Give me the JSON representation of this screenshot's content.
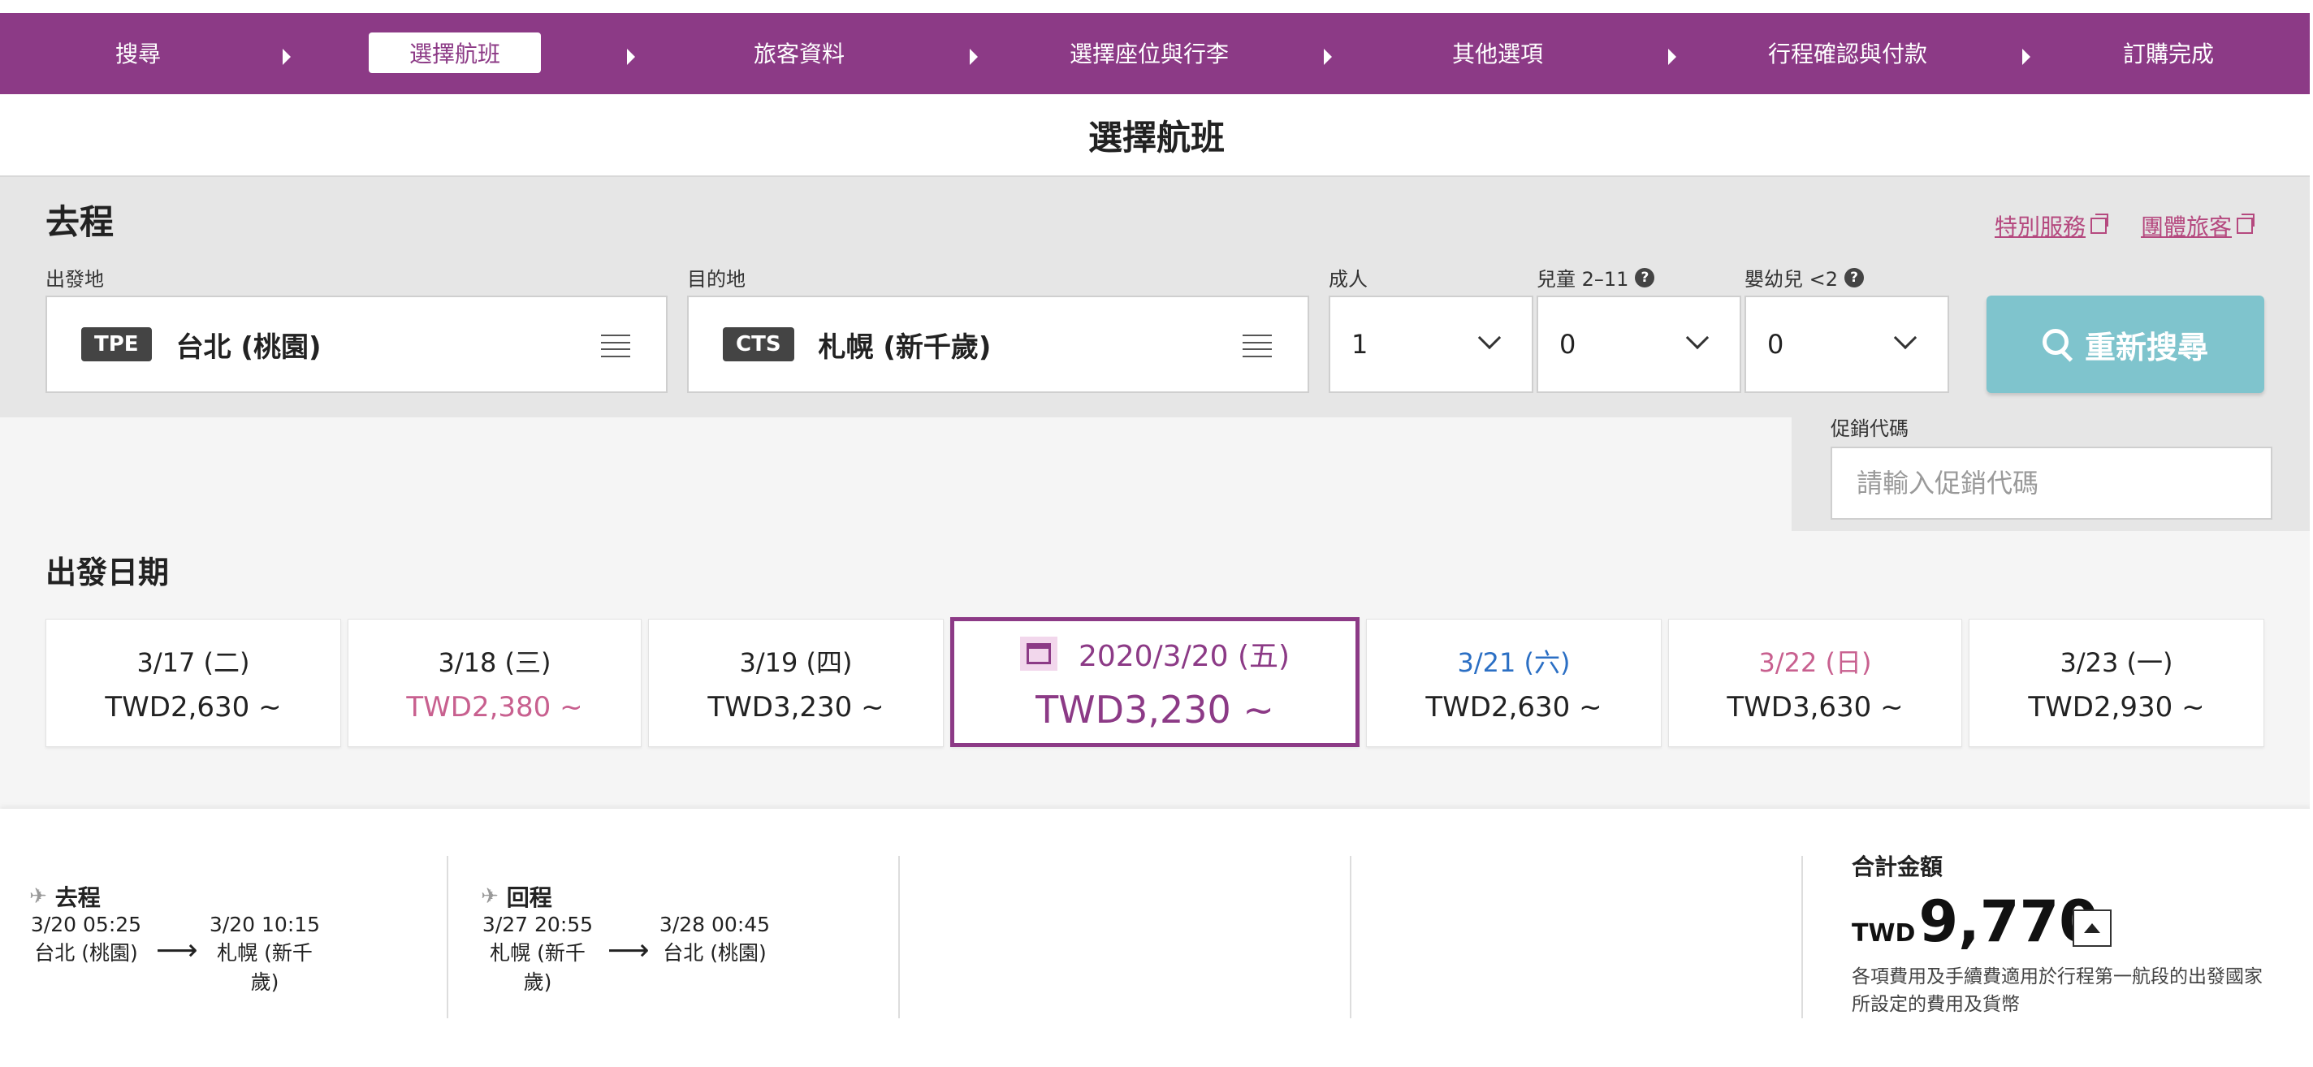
{
  "steps": [
    {
      "label": "搜尋"
    },
    {
      "label": "選擇航班",
      "active": true
    },
    {
      "label": "旅客資料"
    },
    {
      "label": "選擇座位與行李"
    },
    {
      "label": "其他選項"
    },
    {
      "label": "行程確認與付款"
    },
    {
      "label": "訂購完成"
    }
  ],
  "page_title": "選擇航班",
  "search": {
    "section_title": "去程",
    "special_service": "特別服務",
    "group_travel": "團體旅客",
    "origin": {
      "label": "出發地",
      "code": "TPE",
      "name": "台北 (桃園)"
    },
    "destination": {
      "label": "目的地",
      "code": "CTS",
      "name": "札幌 (新千歲)"
    },
    "adults": {
      "label": "成人",
      "value": "1"
    },
    "children": {
      "label": "兒童 2–11",
      "value": "0"
    },
    "infants": {
      "label": "嬰幼兒 <2",
      "value": "0"
    },
    "search_button": "重新搜尋",
    "promo": {
      "label": "促銷代碼",
      "placeholder": "請輸入促銷代碼"
    }
  },
  "dates": {
    "title": "出發日期",
    "cards": [
      {
        "date": "3/17 (二)",
        "price": "TWD2,630 ~"
      },
      {
        "date": "3/18 (三)",
        "price": "TWD2,380 ~",
        "lowest": true
      },
      {
        "date": "3/19 (四)",
        "price": "TWD3,230 ~"
      },
      {
        "date": "2020/3/20 (五)",
        "price": "TWD3,230 ~",
        "selected": true
      },
      {
        "date": "3/21 (六)",
        "price": "TWD2,630 ~",
        "day_type": "saturday"
      },
      {
        "date": "3/22 (日)",
        "price": "TWD3,630 ~",
        "day_type": "sunday"
      },
      {
        "date": "3/23 (一)",
        "price": "TWD2,930 ~"
      }
    ]
  },
  "summary": {
    "outbound": {
      "title": "去程",
      "dep_time": "3/20 05:25",
      "dep_city": "台北 (桃園)",
      "arr_time": "3/20 10:15",
      "arr_city_1": "札幌 (新千",
      "arr_city_2": "歲)"
    },
    "inbound": {
      "title": "回程",
      "dep_time": "3/27 20:55",
      "dep_city_1": "札幌 (新千",
      "dep_city_2": "歲)",
      "arr_time": "3/28 00:45",
      "arr_city": "台北 (桃園)"
    },
    "arrow": "⟶",
    "total_label": "合計金額",
    "currency": "TWD",
    "total": "9,770",
    "note": "各項費用及手續費適用於行程第一航段的出發國家所設定的費用及貨幣"
  },
  "colors": {
    "brand": "#8c3a86",
    "search_button": "#7fc4cd",
    "link": "#b5497f",
    "saturday": "#2b6fc4",
    "sunday": "#c8608f"
  },
  "icons": {
    "list": "list-icon",
    "search": "search-icon",
    "calendar": "calendar-icon",
    "plane": "plane-icon",
    "help": "help-icon",
    "external": "external-link-icon",
    "expand": "caret-up-icon"
  }
}
